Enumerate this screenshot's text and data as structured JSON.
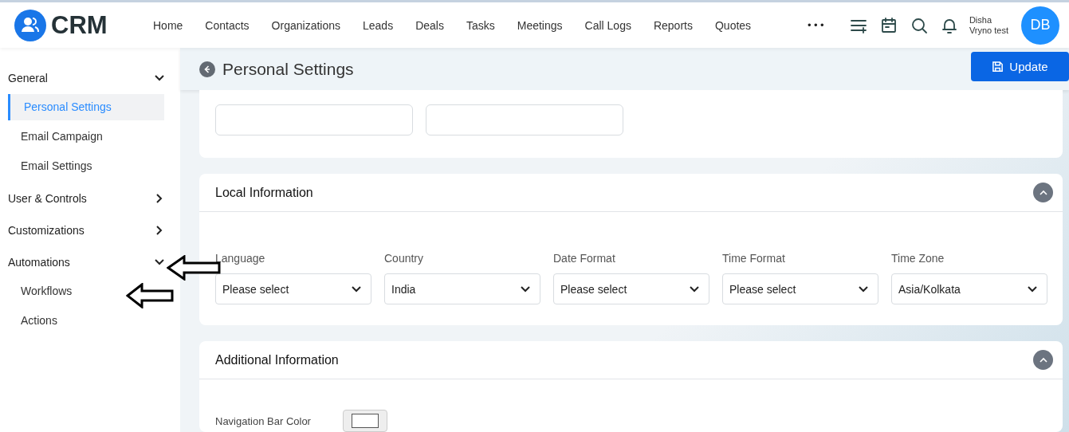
{
  "brand": {
    "name": "CRM"
  },
  "nav": {
    "items": [
      "Home",
      "Contacts",
      "Organizations",
      "Leads",
      "Deals",
      "Tasks",
      "Meetings",
      "Call Logs",
      "Reports",
      "Quotes"
    ],
    "more": "•••"
  },
  "user": {
    "first_line": "Disha",
    "second_line": "Vryno test",
    "initials": "DB"
  },
  "sidebar": {
    "groups": [
      {
        "label": "General",
        "expanded": true,
        "children": [
          {
            "label": "Personal Settings",
            "selected": true
          },
          {
            "label": "Email Campaign",
            "selected": false
          },
          {
            "label": "Email Settings",
            "selected": false
          }
        ]
      },
      {
        "label": "User & Controls",
        "expanded": false
      },
      {
        "label": "Customizations",
        "expanded": false
      },
      {
        "label": "Automations",
        "expanded": true,
        "children": [
          {
            "label": "Workflows",
            "selected": false
          },
          {
            "label": "Actions",
            "selected": false
          }
        ]
      }
    ]
  },
  "page": {
    "title": "Personal Settings",
    "update_button": "Update"
  },
  "top_card": {
    "fields": [
      {
        "kind": "text"
      },
      {
        "kind": "text"
      }
    ]
  },
  "sections": [
    {
      "title": "Local Information",
      "expanded": true,
      "selects": [
        {
          "label": "Language",
          "value": "Please select"
        },
        {
          "label": "Country",
          "value": "India"
        },
        {
          "label": "Date Format",
          "value": "Please select"
        },
        {
          "label": "Time Format",
          "value": "Please select"
        },
        {
          "label": "Time Zone",
          "value": "Asia/Kolkata"
        }
      ]
    },
    {
      "title": "Additional Information",
      "expanded": true,
      "color_fields": [
        {
          "label": "Navigation Bar Color"
        }
      ]
    }
  ]
}
